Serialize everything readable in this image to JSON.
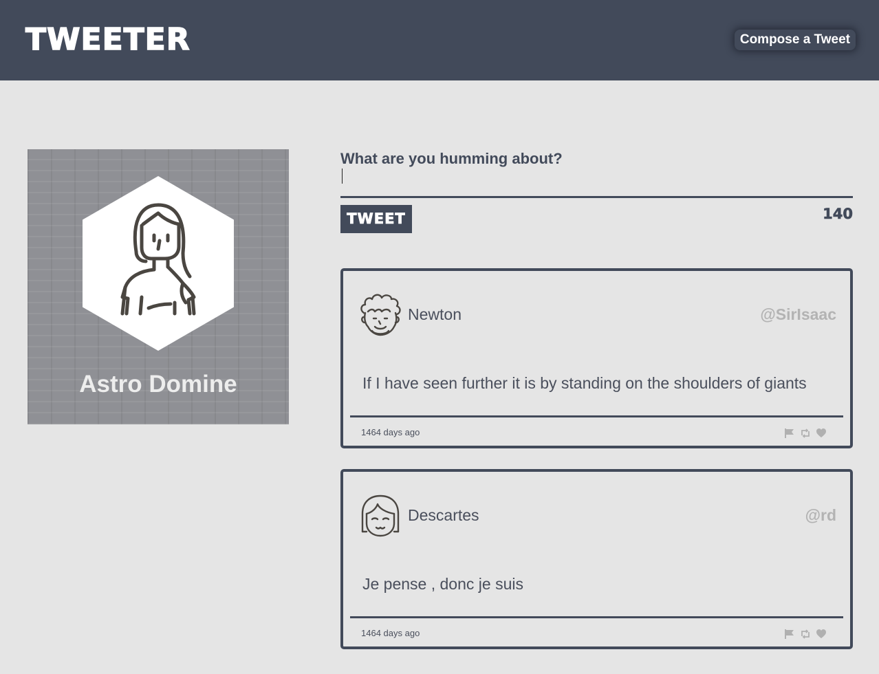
{
  "nav": {
    "brand": "Tweeter",
    "compose_label": "Compose a Tweet"
  },
  "profile": {
    "name": "Astro Domine",
    "avatar_icon": "woman-avatar-icon"
  },
  "new_tweet": {
    "label": "What are you humming about?",
    "text_value": "",
    "button_label": "Tweet",
    "counter": "140"
  },
  "tweets": [
    {
      "name": "Newton",
      "handle": "@SirIsaac",
      "avatar_icon": "curly-hair-man-icon",
      "text": "If I have seen further it is by standing on the shoulders of giants",
      "date": "1464 days ago",
      "actions": [
        "flag-icon",
        "retweet-icon",
        "heart-icon"
      ]
    },
    {
      "name": "Descartes",
      "handle": "@rd",
      "avatar_icon": "bob-hair-face-icon",
      "text": "Je pense , donc je suis",
      "date": "1464 days ago",
      "actions": [
        "flag-icon",
        "retweet-icon",
        "heart-icon"
      ]
    }
  ],
  "colors": {
    "nav_bg": "#424a5a",
    "page_bg": "#e5e5e5",
    "accent": "#424a5a",
    "handle_gray": "#b3b3b3"
  }
}
